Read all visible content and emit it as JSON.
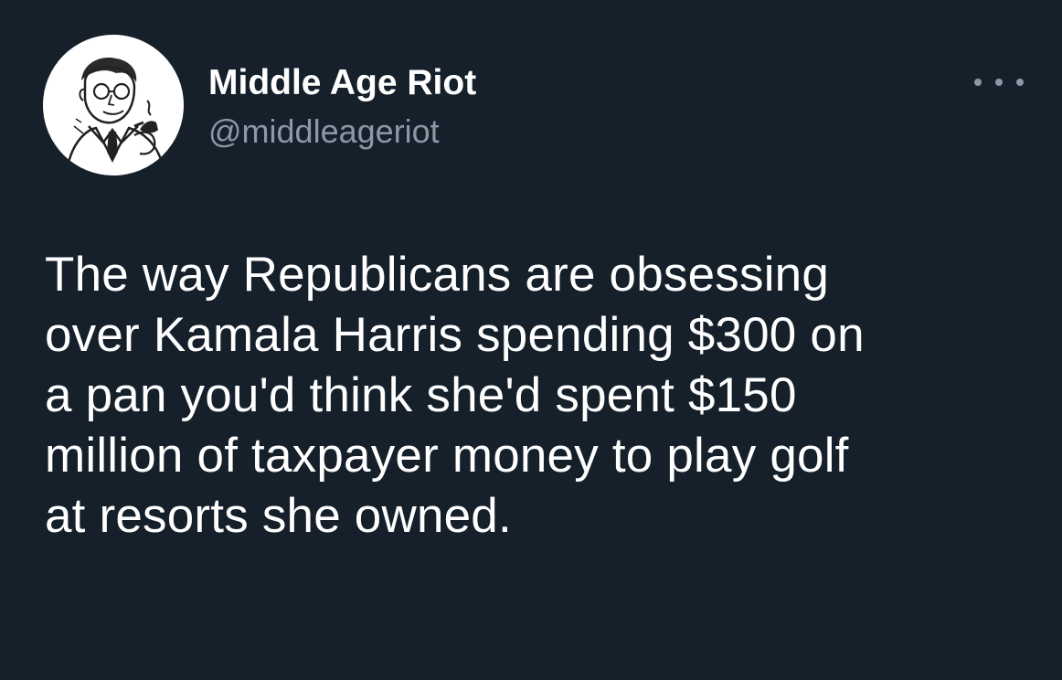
{
  "tweet": {
    "author": {
      "display_name": "Middle Age Riot",
      "handle": "@middleageriot",
      "avatar_icon": "retro-man-with-pipe-avatar"
    },
    "more_icon": "more-dots-icon",
    "text_lines": [
      "The way Republicans are obsessing",
      "over Kamala Harris spending $300 on",
      "a pan you'd think she'd spent $150",
      "million of taxpayer money to play golf",
      "at resorts she owned."
    ]
  },
  "colors": {
    "background": "#15202b",
    "primary_text": "#ffffff",
    "secondary_text": "#8b98a5"
  }
}
